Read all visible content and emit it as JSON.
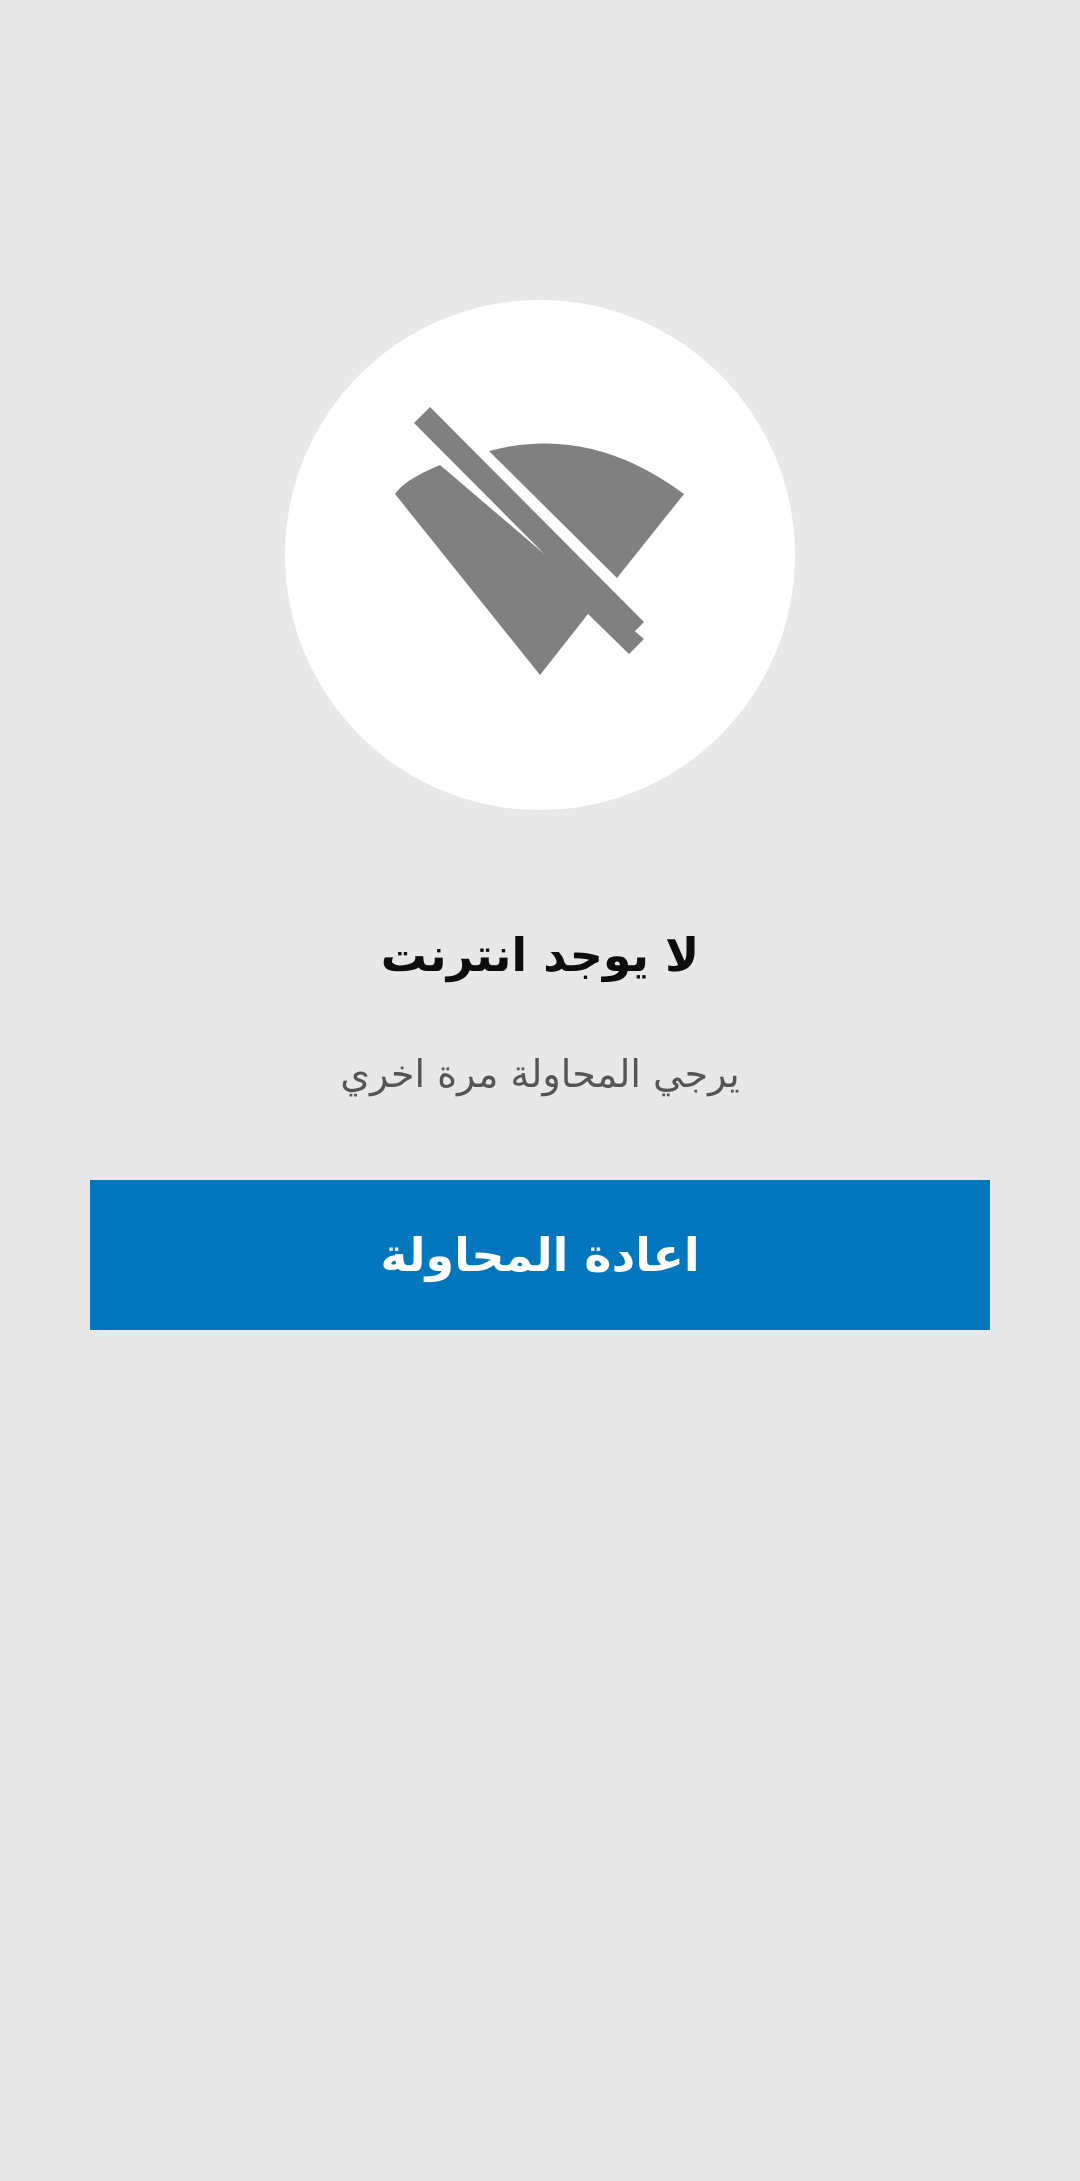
{
  "status": {
    "icon": "wifi-off-icon",
    "title": "لا يوجد انترنت",
    "message": "يرجي المحاولة مرة اخري"
  },
  "actions": {
    "retry_label": "اعادة المحاولة"
  },
  "colors": {
    "background": "#e8e8e8",
    "icon_circle": "#ffffff",
    "icon": "#808080",
    "button": "#0277bd",
    "button_text": "#ffffff",
    "title_text": "#0d0d0d",
    "message_text": "#555555"
  }
}
